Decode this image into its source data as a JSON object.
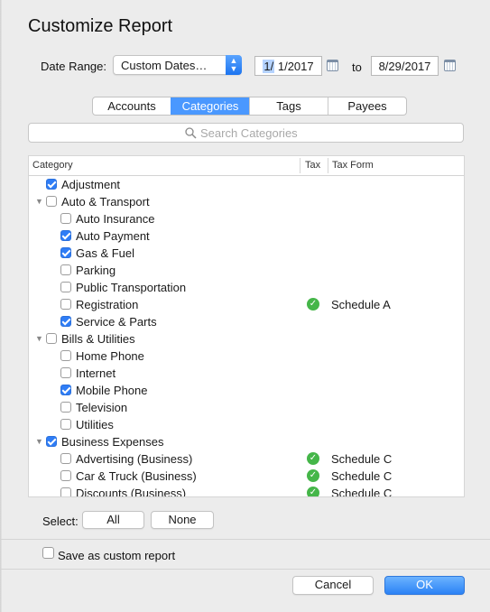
{
  "title": "Customize Report",
  "date_range": {
    "label": "Date Range:",
    "value": "Custom Dates…",
    "from_month_day": "1/",
    "from_rest": " 1/2017",
    "to_label": "to",
    "to_date": "8/29/2017"
  },
  "tabs": [
    {
      "label": "Accounts",
      "active": false
    },
    {
      "label": "Categories",
      "active": true
    },
    {
      "label": "Tags",
      "active": false
    },
    {
      "label": "Payees",
      "active": false
    }
  ],
  "search": {
    "placeholder": "Search Categories"
  },
  "table": {
    "headers": {
      "category": "Category",
      "tax": "Tax",
      "tax_form": "Tax Form"
    },
    "rows": [
      {
        "name": "Adjustment",
        "level": 0,
        "group": false,
        "checked": true,
        "tax": false,
        "tax_form": ""
      },
      {
        "name": "Auto & Transport",
        "level": 0,
        "group": true,
        "checked": false,
        "tax": false,
        "tax_form": ""
      },
      {
        "name": "Auto Insurance",
        "level": 1,
        "group": false,
        "checked": false,
        "tax": false,
        "tax_form": ""
      },
      {
        "name": "Auto Payment",
        "level": 1,
        "group": false,
        "checked": true,
        "tax": false,
        "tax_form": ""
      },
      {
        "name": "Gas & Fuel",
        "level": 1,
        "group": false,
        "checked": true,
        "tax": false,
        "tax_form": ""
      },
      {
        "name": "Parking",
        "level": 1,
        "group": false,
        "checked": false,
        "tax": false,
        "tax_form": ""
      },
      {
        "name": "Public Transportation",
        "level": 1,
        "group": false,
        "checked": false,
        "tax": false,
        "tax_form": ""
      },
      {
        "name": "Registration",
        "level": 1,
        "group": false,
        "checked": false,
        "tax": true,
        "tax_form": "Schedule A"
      },
      {
        "name": "Service & Parts",
        "level": 1,
        "group": false,
        "checked": true,
        "tax": false,
        "tax_form": ""
      },
      {
        "name": "Bills & Utilities",
        "level": 0,
        "group": true,
        "checked": false,
        "tax": false,
        "tax_form": ""
      },
      {
        "name": "Home Phone",
        "level": 1,
        "group": false,
        "checked": false,
        "tax": false,
        "tax_form": ""
      },
      {
        "name": "Internet",
        "level": 1,
        "group": false,
        "checked": false,
        "tax": false,
        "tax_form": ""
      },
      {
        "name": "Mobile Phone",
        "level": 1,
        "group": false,
        "checked": true,
        "tax": false,
        "tax_form": ""
      },
      {
        "name": "Television",
        "level": 1,
        "group": false,
        "checked": false,
        "tax": false,
        "tax_form": ""
      },
      {
        "name": "Utilities",
        "level": 1,
        "group": false,
        "checked": false,
        "tax": false,
        "tax_form": ""
      },
      {
        "name": "Business Expenses",
        "level": 0,
        "group": true,
        "checked": true,
        "tax": false,
        "tax_form": ""
      },
      {
        "name": "Advertising (Business)",
        "level": 1,
        "group": false,
        "checked": false,
        "tax": true,
        "tax_form": "Schedule C"
      },
      {
        "name": "Car & Truck (Business)",
        "level": 1,
        "group": false,
        "checked": false,
        "tax": true,
        "tax_form": "Schedule C"
      },
      {
        "name": "Discounts (Business)",
        "level": 1,
        "group": false,
        "checked": false,
        "tax": true,
        "tax_form": "Schedule C"
      }
    ]
  },
  "select": {
    "label": "Select:",
    "all": "All",
    "none": "None"
  },
  "save_custom": {
    "label": "Save as custom report",
    "checked": false
  },
  "buttons": {
    "cancel": "Cancel",
    "ok": "OK"
  },
  "colors": {
    "accent": "#4a98ff",
    "check": "#2f7df6",
    "tax_ok": "#45b649"
  }
}
